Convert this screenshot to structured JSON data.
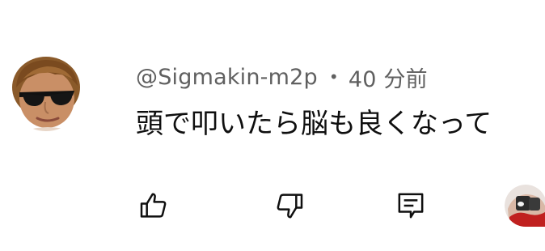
{
  "comment": {
    "author": "@Sigmakin-m2p",
    "separator": "•",
    "time_ago": "40 分前",
    "text": "頭で叩いたら脳も良くなって"
  },
  "icons": {
    "like": "thumbs-up-icon",
    "dislike": "thumbs-down-icon",
    "reply": "comment-reply-icon"
  },
  "colors": {
    "meta_text": "#606060",
    "body_text": "#0f0f0f",
    "icon": "#0f0f0f",
    "background": "#ffffff"
  }
}
